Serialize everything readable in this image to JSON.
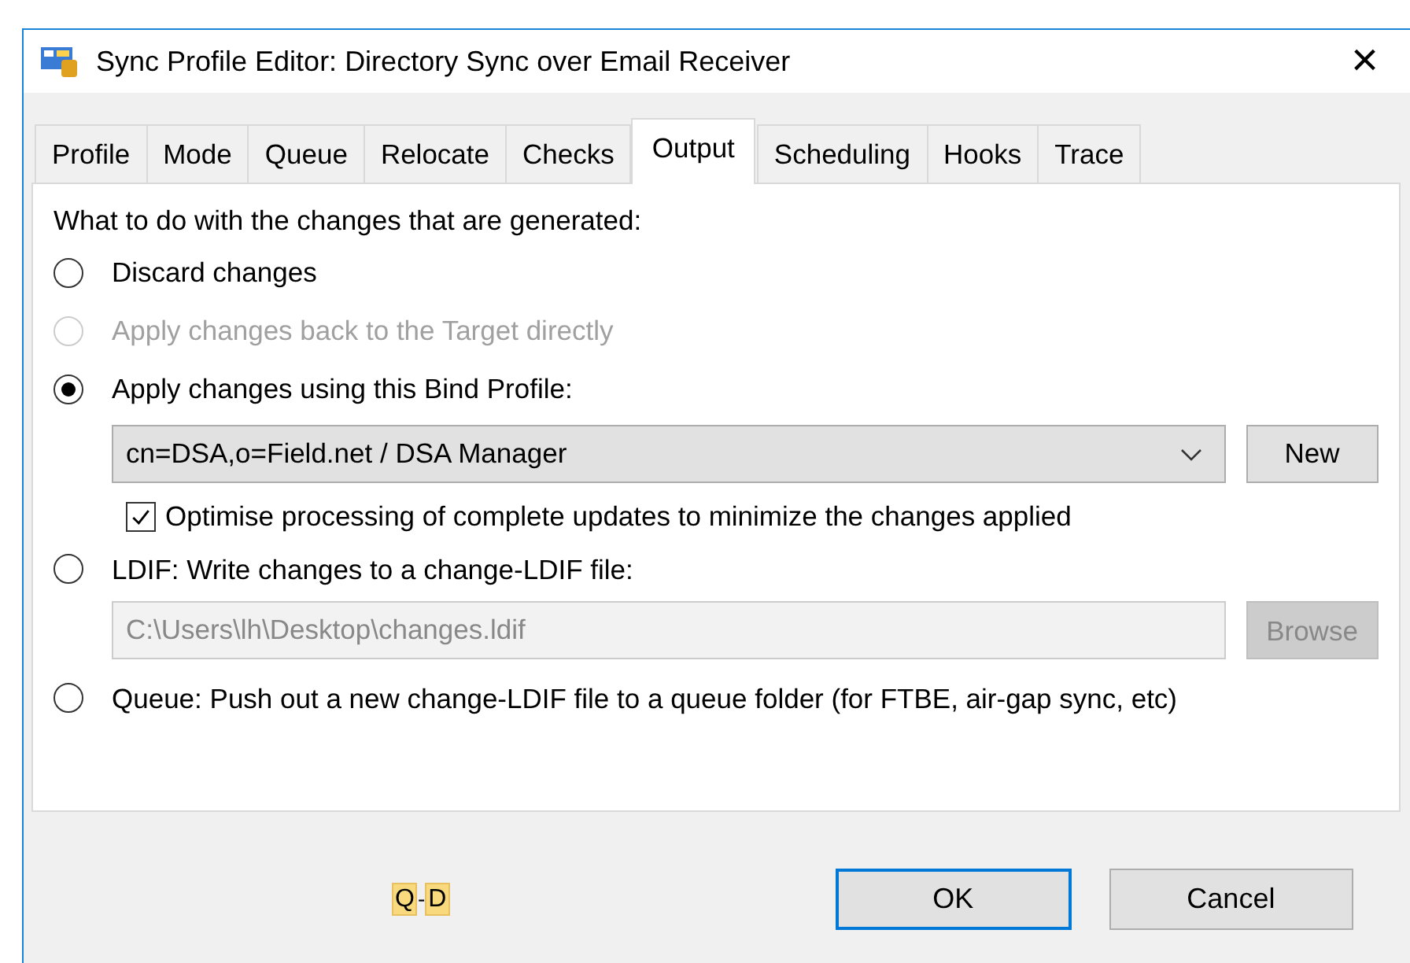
{
  "window": {
    "title": "Sync Profile Editor: Directory Sync over Email Receiver",
    "close": "×"
  },
  "tabs": [
    {
      "label": "Profile",
      "selected": false
    },
    {
      "label": "Mode",
      "selected": false
    },
    {
      "label": "Queue",
      "selected": false
    },
    {
      "label": "Relocate",
      "selected": false
    },
    {
      "label": "Checks",
      "selected": false
    },
    {
      "label": "Output",
      "selected": true
    },
    {
      "label": "Scheduling",
      "selected": false
    },
    {
      "label": "Hooks",
      "selected": false
    },
    {
      "label": "Trace",
      "selected": false
    }
  ],
  "heading": "What to do with the changes that are generated:",
  "options": [
    {
      "label": "Discard changes",
      "selected": false,
      "disabled": false
    },
    {
      "label": "Apply changes back to the Target directly",
      "selected": false,
      "disabled": true
    },
    {
      "label": "Apply changes using this Bind Profile:",
      "selected": true,
      "disabled": false,
      "profile": {
        "value": "cn=DSA,o=Field.net / DSA Manager",
        "button": "New"
      },
      "optimise": {
        "label": "Optimise processing of complete updates to minimize the changes applied",
        "checked": true
      }
    },
    {
      "label": "LDIF: Write changes to a change-LDIF file:",
      "selected": false,
      "disabled": false,
      "file": {
        "value": "C:\\Users\\lh\\Desktop\\changes.ldif",
        "button": "Browse",
        "disabled": true
      }
    },
    {
      "label": "Queue: Push out a new change-LDIF file to a queue folder (for FTBE, air-gap sync, etc)",
      "selected": false,
      "disabled": false
    }
  ],
  "badge": {
    "parts": [
      "Q",
      "D"
    ],
    "separator": "-"
  },
  "buttons": [
    {
      "label": "OK",
      "default": true
    },
    {
      "label": "Cancel",
      "default": false
    }
  ]
}
